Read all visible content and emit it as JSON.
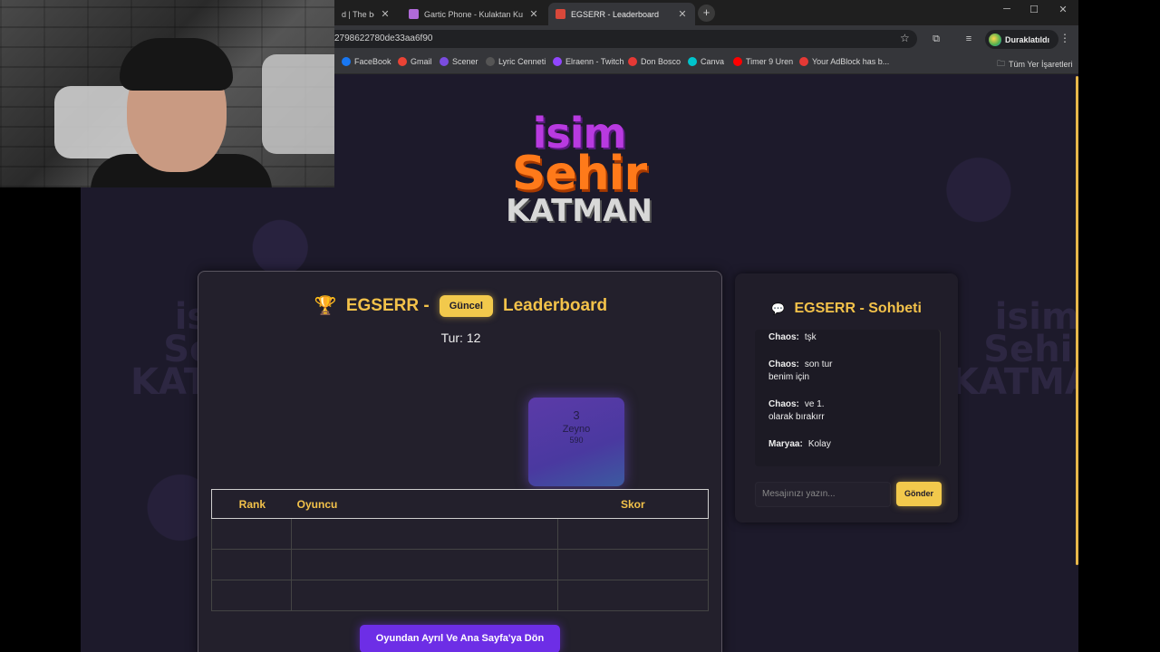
{
  "browser": {
    "tabs": [
      {
        "label": "d | The best",
        "icon": "page-icon",
        "color": "#888888"
      },
      {
        "label": "Gartic Phone - Kulaktan Kulağa",
        "icon": "phone-icon",
        "color": "#b06ad8"
      },
      {
        "label": "EGSERR - Leaderboard",
        "icon": "game-icon",
        "color": "#d8483a",
        "active": true
      }
    ],
    "url": "2798622780de33aa6f90",
    "profile_label": "Duraklatıldı",
    "bookmarks": [
      {
        "label": "FaceBook",
        "color": "#1877f2"
      },
      {
        "label": "Gmail",
        "color": "#ea4335"
      },
      {
        "label": "Scener",
        "color": "#7b4ce0"
      },
      {
        "label": "Lyric Cenneti",
        "color": "#333333"
      },
      {
        "label": "Elraenn - Twitch",
        "color": "#9146ff"
      },
      {
        "label": "Don Bosco",
        "color": "#e53935"
      },
      {
        "label": "Canva",
        "color": "#00c4cc"
      },
      {
        "label": "Timer 9 Uren",
        "color": "#ff0000"
      },
      {
        "label": "Your AdBlock has b...",
        "color": "#e53935"
      }
    ],
    "all_bookmarks": "Tüm Yer İşaretleri"
  },
  "logo": {
    "line1": "isim",
    "line2": "Sehir",
    "line3": "KATMAN"
  },
  "leaderboard": {
    "title_prefix": "EGSERR -",
    "badge": "Güncel",
    "title_suffix": "Leaderboard",
    "round": "Tur: 12",
    "podium": {
      "rank": "3",
      "name": "Zeyno",
      "score": "590"
    },
    "columns": [
      "Rank",
      "Oyuncu",
      "Skor"
    ],
    "rows": [
      [
        "",
        "",
        ""
      ],
      [
        "",
        "",
        ""
      ],
      [
        "",
        "",
        ""
      ]
    ],
    "leave_button": "Oyundan Ayrıl Ve Ana Sayfa'ya Dön"
  },
  "chat": {
    "title": "EGSERR - Sohbeti",
    "messages": [
      {
        "user": "Chaos:",
        "text": "tşk"
      },
      {
        "user": "Chaos:",
        "text": "son tur benim için"
      },
      {
        "user": "Chaos:",
        "text": "ve 1. olarak bırakırr"
      },
      {
        "user": "Maryaa:",
        "text": "Kolay"
      }
    ],
    "input_placeholder": "Mesajınızı yazın...",
    "send_button": "Gönder"
  }
}
